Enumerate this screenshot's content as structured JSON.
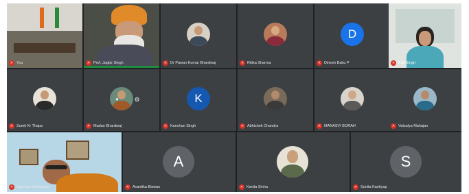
{
  "participants": [
    {
      "name": "You"
    },
    {
      "name": "Prof. Jagbir Singh",
      "prefix": "Pin"
    },
    {
      "name": "Dr Pawan Kumar Bhardwaj"
    },
    {
      "name": "Ritika Sharma"
    },
    {
      "name": "Dinesh Babu P",
      "initial": "D",
      "color": "#1a73e8"
    },
    {
      "name": "Kirti Singh"
    },
    {
      "name": "Sumit Kr Thapa"
    },
    {
      "name": "Madan Bhardwaj"
    },
    {
      "name": "Kanchan Singh",
      "initial": "K",
      "color": "#1558b0"
    },
    {
      "name": "Abhishek Chandra"
    },
    {
      "name": "MANASVI BORAH"
    },
    {
      "name": "Vatsalya Mahajan"
    },
    {
      "name": "Sanchar Mukherjee"
    },
    {
      "name": "Avantika Biswas",
      "initial": "A",
      "color": "#5f6368"
    },
    {
      "name": "Kavita Sinha"
    },
    {
      "name": "Sunita Kashyap",
      "initial": "S",
      "color": "#5f6368"
    }
  ],
  "icons": {
    "mic_muted": "mic-off-icon"
  }
}
